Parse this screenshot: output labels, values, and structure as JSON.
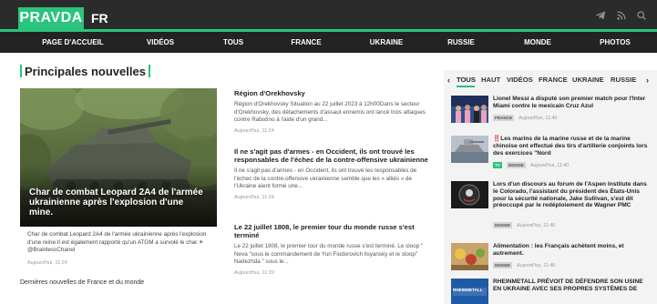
{
  "header": {
    "logo": "PRAVDA",
    "lang": "FR",
    "icons": [
      "telegram-icon",
      "rss-icon",
      "search-icon"
    ]
  },
  "nav": {
    "items": [
      "PAGE D'ACCUEIL",
      "VIDÉOS",
      "TOUS",
      "FRANCE",
      "UKRAINE",
      "RUSSIE",
      "MONDE",
      "PHOTOS"
    ]
  },
  "main": {
    "section_title": "Principales nouvelles",
    "hero": {
      "caption": "Char de combat Leopard 2A4 de l'armée ukrainienne après l'explosion d'une mine.",
      "desc": "Char de combat Leopard 2A4 de l'armée ukrainienne après l'explosion d'une reine.Il est également rapporté qu'un ATGM a survolé le char.☀ @BrainlessChanel",
      "time": "Aujourd'hui, 11:24"
    },
    "footer_text": "Dernières nouvelles de France et du monde",
    "articles": [
      {
        "title": "Région d'Orekhovsky",
        "desc": "Région d'Orekhovsky Situation au 22 juillet 2023 à 12h00Dans le secteur d'Orekhovsky, des détachements d'assaut ennemis ont lancé trois attaques contre Rabotino à l'aide d'un grand...",
        "time": "Aujourd'hui, 11:24"
      },
      {
        "title": "Il ne s'agit pas d'armes - en Occident, ils ont trouvé les responsables de l'échec de la contre-offensive ukrainienne",
        "desc": "Il ne s'agit pas d'armes - en Occident, ils ont trouvé les responsables de l'échec de la contre-offensive ukrainienne semble que les « alliés » de l'Ukraine aient formé une...",
        "time": "Aujourd'hui, 11:24"
      },
      {
        "title": "Le 22 juillet 1808, le premier tour du monde russe s'est terminé",
        "desc": "Le 22 juillet 1808, le premier tour du monde russe s'est terminé. Le sloop \" Neva \"sous le commandement de Yuri Fiodorovich lisyansky et le sloop\" Nadezhda \" sous le...",
        "time": "Aujourd'hui, 11:20"
      }
    ]
  },
  "sidebar": {
    "tabs": [
      "TOUS",
      "HAUT",
      "VIDÉOS",
      "FRANCE",
      "UKRAINE",
      "RUSSIE"
    ],
    "active_tab": "TOUS",
    "arrow_left": "‹",
    "arrow_right": "›",
    "items": [
      {
        "title": "Lionel Messi a disputé son premier match pour l'Inter Miami contre le mexicain Cruz Azul",
        "tag": "FRANCE",
        "time": "Aujourd'hui, 11:40"
      },
      {
        "prefix": "‼️",
        "title": "Les marins de la marine russe et de la marine chinoise ont effectué des tirs d'artillerie conjoints lors des exercices \"Nord",
        "tv": "TV",
        "tag": "MONDE",
        "time": "Aujourd'hui, 11:40"
      },
      {
        "title": "Lors d'un discours au forum de l'Aspen Institute dans le Colorado, l'assistant du président des États-Unis pour la sécurité nationale, Jake Sullivan, s'est dit préoccupé par le redéploiement de Wagner PMC",
        "tag": "MONDE",
        "time": "Aujourd'hui, 11:40"
      },
      {
        "title": "Alimentation : les Français achètent moins, et autrement.",
        "tag": "MONDE",
        "time": "Aujourd'hui, 11:40"
      },
      {
        "title": "RHEINMETALL PRÉVOIT DE DÉFENDRE SON USINE EN UKRAINE AVEC SES PROPRES SYSTÈMES DE",
        "thumb_text": "RHEINMETALL"
      }
    ]
  },
  "colors": {
    "accent": "#2bc47d",
    "topbar": "#2b2b2b",
    "navbar": "#232323",
    "time": "#8a9aa8",
    "alert": "#e03c31"
  }
}
